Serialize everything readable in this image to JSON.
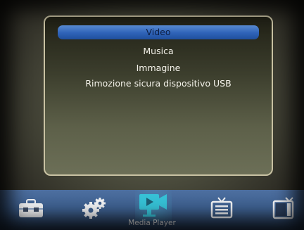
{
  "menu": {
    "items": [
      {
        "label": "Video"
      },
      {
        "label": "Musica"
      },
      {
        "label": "Immagine"
      },
      {
        "label": "Rimozione sicura dispositivo USB"
      }
    ],
    "selected_index": 0
  },
  "dock": {
    "active_label": "Media Player",
    "icons": [
      "toolbox-icon",
      "settings-gears-icon",
      "media-player-icon",
      "tv-guide-icon",
      "tv-icon"
    ]
  },
  "colors": {
    "highlight": "#2f63b8",
    "menu_border": "#c9c2a3",
    "dock": "#3d5f8e",
    "active_icon": "#36c1d6"
  }
}
